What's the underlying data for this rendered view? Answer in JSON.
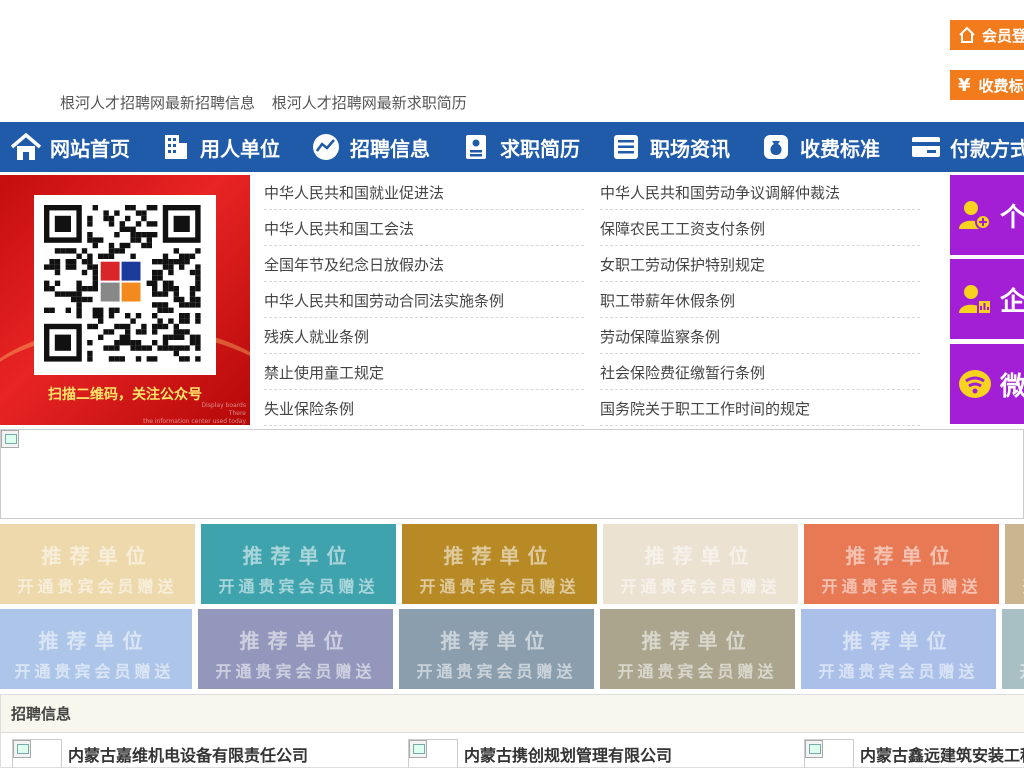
{
  "header": {
    "top_links": [
      "根河人才招聘网最新招聘信息",
      "根河人才招聘网最新求职简历"
    ],
    "member_login": "会员登",
    "fee_standard_btn": "收费标"
  },
  "nav": [
    {
      "label": "网站首页",
      "icon": "home-icon"
    },
    {
      "label": "用人单位",
      "icon": "building-icon"
    },
    {
      "label": "招聘信息",
      "icon": "chart-icon"
    },
    {
      "label": "求职简历",
      "icon": "resume-icon"
    },
    {
      "label": "职场资讯",
      "icon": "news-icon"
    },
    {
      "label": "收费标准",
      "icon": "money-bag-icon"
    },
    {
      "label": "付款方式",
      "icon": "card-icon"
    }
  ],
  "qr": {
    "caption": "扫描二维码，关注公众号",
    "small_text": "Display boards\nThere\nthe information center used today"
  },
  "laws": [
    [
      "中华人民共和国就业促进法",
      "中华人民共和国劳动争议调解仲裁法"
    ],
    [
      "中华人民共和国工会法",
      "保障农民工工资支付条例"
    ],
    [
      "全国年节及纪念日放假办法",
      "女职工劳动保护特别规定"
    ],
    [
      "中华人民共和国劳动合同法实施条例",
      "职工带薪年休假条例"
    ],
    [
      "残疾人就业条例",
      "劳动保障监察条例"
    ],
    [
      "禁止使用童工规定",
      "社会保险费征缴暂行条例"
    ],
    [
      "失业保险条例",
      "国务院关于职工工作时间的规定"
    ]
  ],
  "side_buttons": [
    {
      "label": "个",
      "icon": "person-add-icon"
    },
    {
      "label": "企",
      "icon": "company-icon"
    },
    {
      "label": "微",
      "icon": "wechat-icon"
    }
  ],
  "tiles": {
    "title": "推荐单位",
    "subtitle": "开通贵宾会员赠送",
    "row1_colors": [
      "#eed9ad",
      "#3fa3ad",
      "#b78a25",
      "#ece2d2",
      "#e87955",
      "#c9b691"
    ],
    "row2_colors": [
      "#adc5e8",
      "#9297bb",
      "#8b9eae",
      "#aba58e",
      "#aac0e9",
      "#a8c0c4"
    ]
  },
  "jobs": {
    "header": "招聘信息",
    "items": [
      "内蒙古嘉维机电设备有限责任公司",
      "内蒙古携创规划管理有限公司",
      "内蒙古鑫远建筑安装工程"
    ]
  },
  "colors": {
    "nav_bg": "#1f5ba9",
    "orange": "#f27b1c",
    "purple": "#a21fd6"
  }
}
